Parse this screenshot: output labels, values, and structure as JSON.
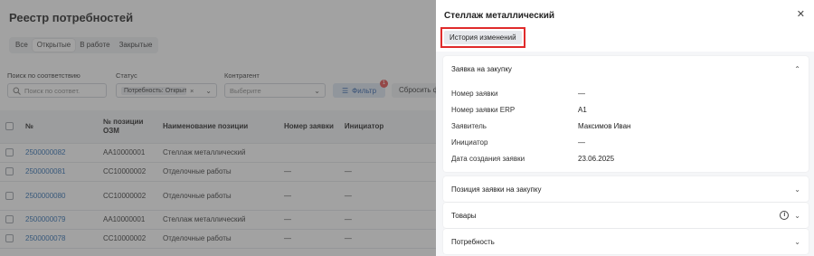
{
  "registry": {
    "title": "Реестр потребностей",
    "tabs": [
      "Все",
      "Открытые",
      "В работе",
      "Закрытые"
    ],
    "active_tab": "Открытые",
    "filters": {
      "search_label": "Поиск по соответствию",
      "search_placeholder": "Поиск по соответ.",
      "status_label": "Статус",
      "status_value": "Потребность: Открыт",
      "contractor_label": "Контрагент",
      "contractor_placeholder": "Выберите",
      "filter_button": "Фильтр",
      "filter_badge": "1",
      "reset_button": "Сбросить ф"
    },
    "columns": [
      "№",
      "№ позиции ОЗМ",
      "Наименование позиции",
      "Номер заявки",
      "Инициатор"
    ],
    "rows": [
      {
        "num": "2500000082",
        "ozm": "АА10000001",
        "name": "Стеллаж металлический",
        "req": "",
        "init": ""
      },
      {
        "num": "2500000081",
        "ozm": "СС10000002",
        "name": "Отделочные работы",
        "req": "—",
        "init": "—"
      },
      {
        "num": "2500000080",
        "ozm": "СС10000002",
        "name": "Отделочные работы",
        "req": "—",
        "init": "—"
      },
      {
        "num": "2500000079",
        "ozm": "АА10000001",
        "name": "Стеллаж металлический",
        "req": "—",
        "init": "—"
      },
      {
        "num": "2500000078",
        "ozm": "СС10000002",
        "name": "Отделочные работы",
        "req": "—",
        "init": "—"
      }
    ]
  },
  "drawer": {
    "title": "Стеллаж металлический",
    "history_button": "История изменений",
    "close_icon": "close-icon",
    "sections": {
      "request": {
        "title": "Заявка на закупку",
        "expanded": true,
        "fields": [
          {
            "label": "Номер заявки",
            "value": "—"
          },
          {
            "label": "Номер заявки ERP",
            "value": "A1"
          },
          {
            "label": "Заявитель",
            "value": "Максимов Иван"
          },
          {
            "label": "Инициатор",
            "value": "—"
          },
          {
            "label": "Дата создания заявки",
            "value": "23.06.2025"
          }
        ]
      },
      "position": {
        "title": "Позиция заявки на закупку"
      },
      "goods": {
        "title": "Товары"
      },
      "need": {
        "title": "Потребность"
      }
    }
  },
  "colors": {
    "accent": "#2b6cb0",
    "highlight": "#e02b2b",
    "badge": "#e24a4a"
  }
}
